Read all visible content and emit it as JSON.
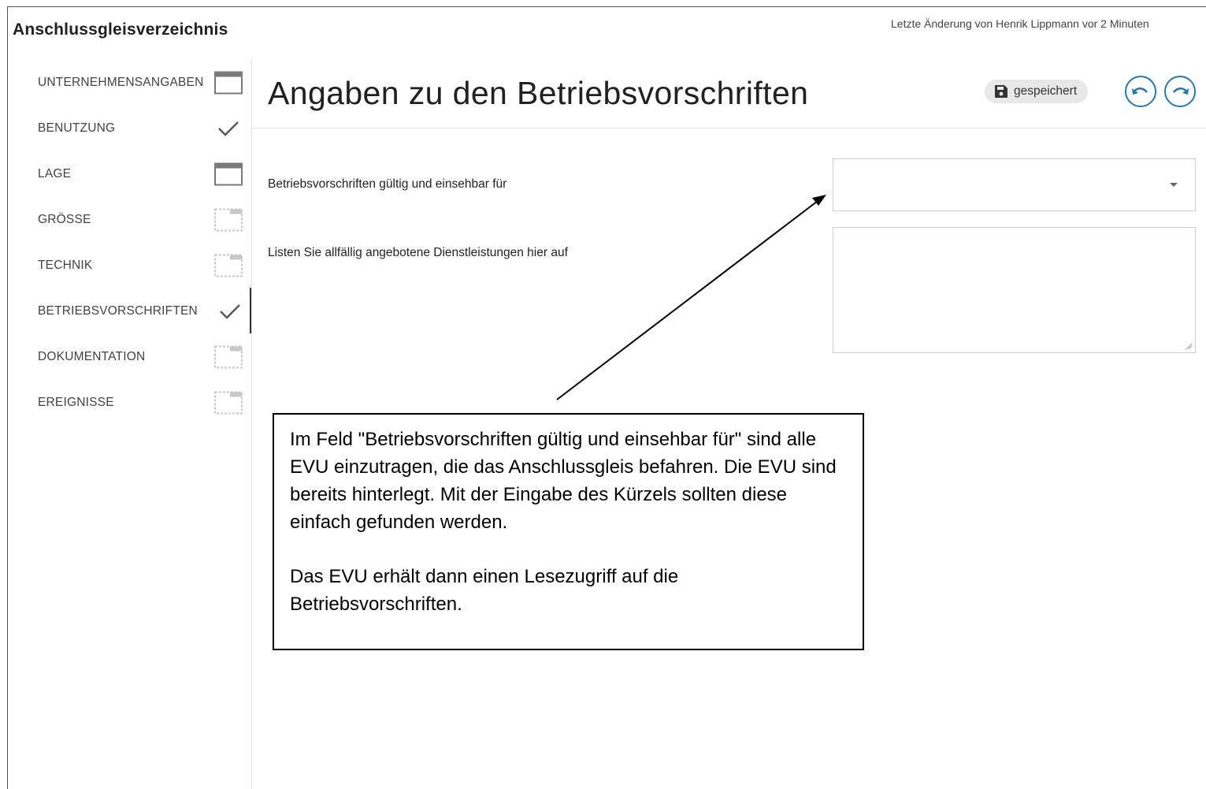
{
  "app": {
    "title": "Anschlussgleisverzeichnis",
    "last_change": "Letzte Änderung von Henrik Lippmann vor 2 Minuten"
  },
  "sidebar": {
    "items": [
      {
        "label": "UNTERNEHMENSANGABEN",
        "status": "empty",
        "icon": "window-icon"
      },
      {
        "label": "BENUTZUNG",
        "status": "done",
        "icon": "check-icon"
      },
      {
        "label": "LAGE",
        "status": "empty",
        "icon": "window-icon"
      },
      {
        "label": "GRÖSSE",
        "status": "todo",
        "icon": "dashed-window-icon"
      },
      {
        "label": "TECHNIK",
        "status": "todo",
        "icon": "dashed-window-icon"
      },
      {
        "label": "BETRIEBSVORSCHRIFTEN",
        "status": "done",
        "icon": "check-icon",
        "active": true
      },
      {
        "label": "DOKUMENTATION",
        "status": "todo",
        "icon": "dashed-window-icon"
      },
      {
        "label": "EREIGNISSE",
        "status": "todo",
        "icon": "dashed-window-icon"
      }
    ]
  },
  "main": {
    "title": "Angaben zu den Betriebsvorschriften",
    "saved_label": "gespeichert",
    "undo_icon": "undo-icon",
    "redo_icon": "redo-icon",
    "fields": {
      "valid_for_label": "Betriebsvorschriften gültig und einsehbar für",
      "valid_for_value": "",
      "services_label": "Listen Sie allfällig angebotene Dienstleistungen hier auf",
      "services_value": ""
    }
  },
  "callout": {
    "paragraph1": "Im Feld \"Betriebsvorschriften gültig und einsehbar für\" sind alle EVU einzutragen, die das Anschlussgleis befahren. Die EVU sind bereits hinterlegt. Mit der Eingabe des Kürzels sollten diese einfach gefunden werden.",
    "paragraph2": "Das EVU erhält dann einen Lesezugriff auf die Betriebsvorschriften."
  },
  "colors": {
    "accent": "#1e7bb6",
    "chip_bg": "#e8e8e8",
    "border": "#cfcfcf"
  }
}
